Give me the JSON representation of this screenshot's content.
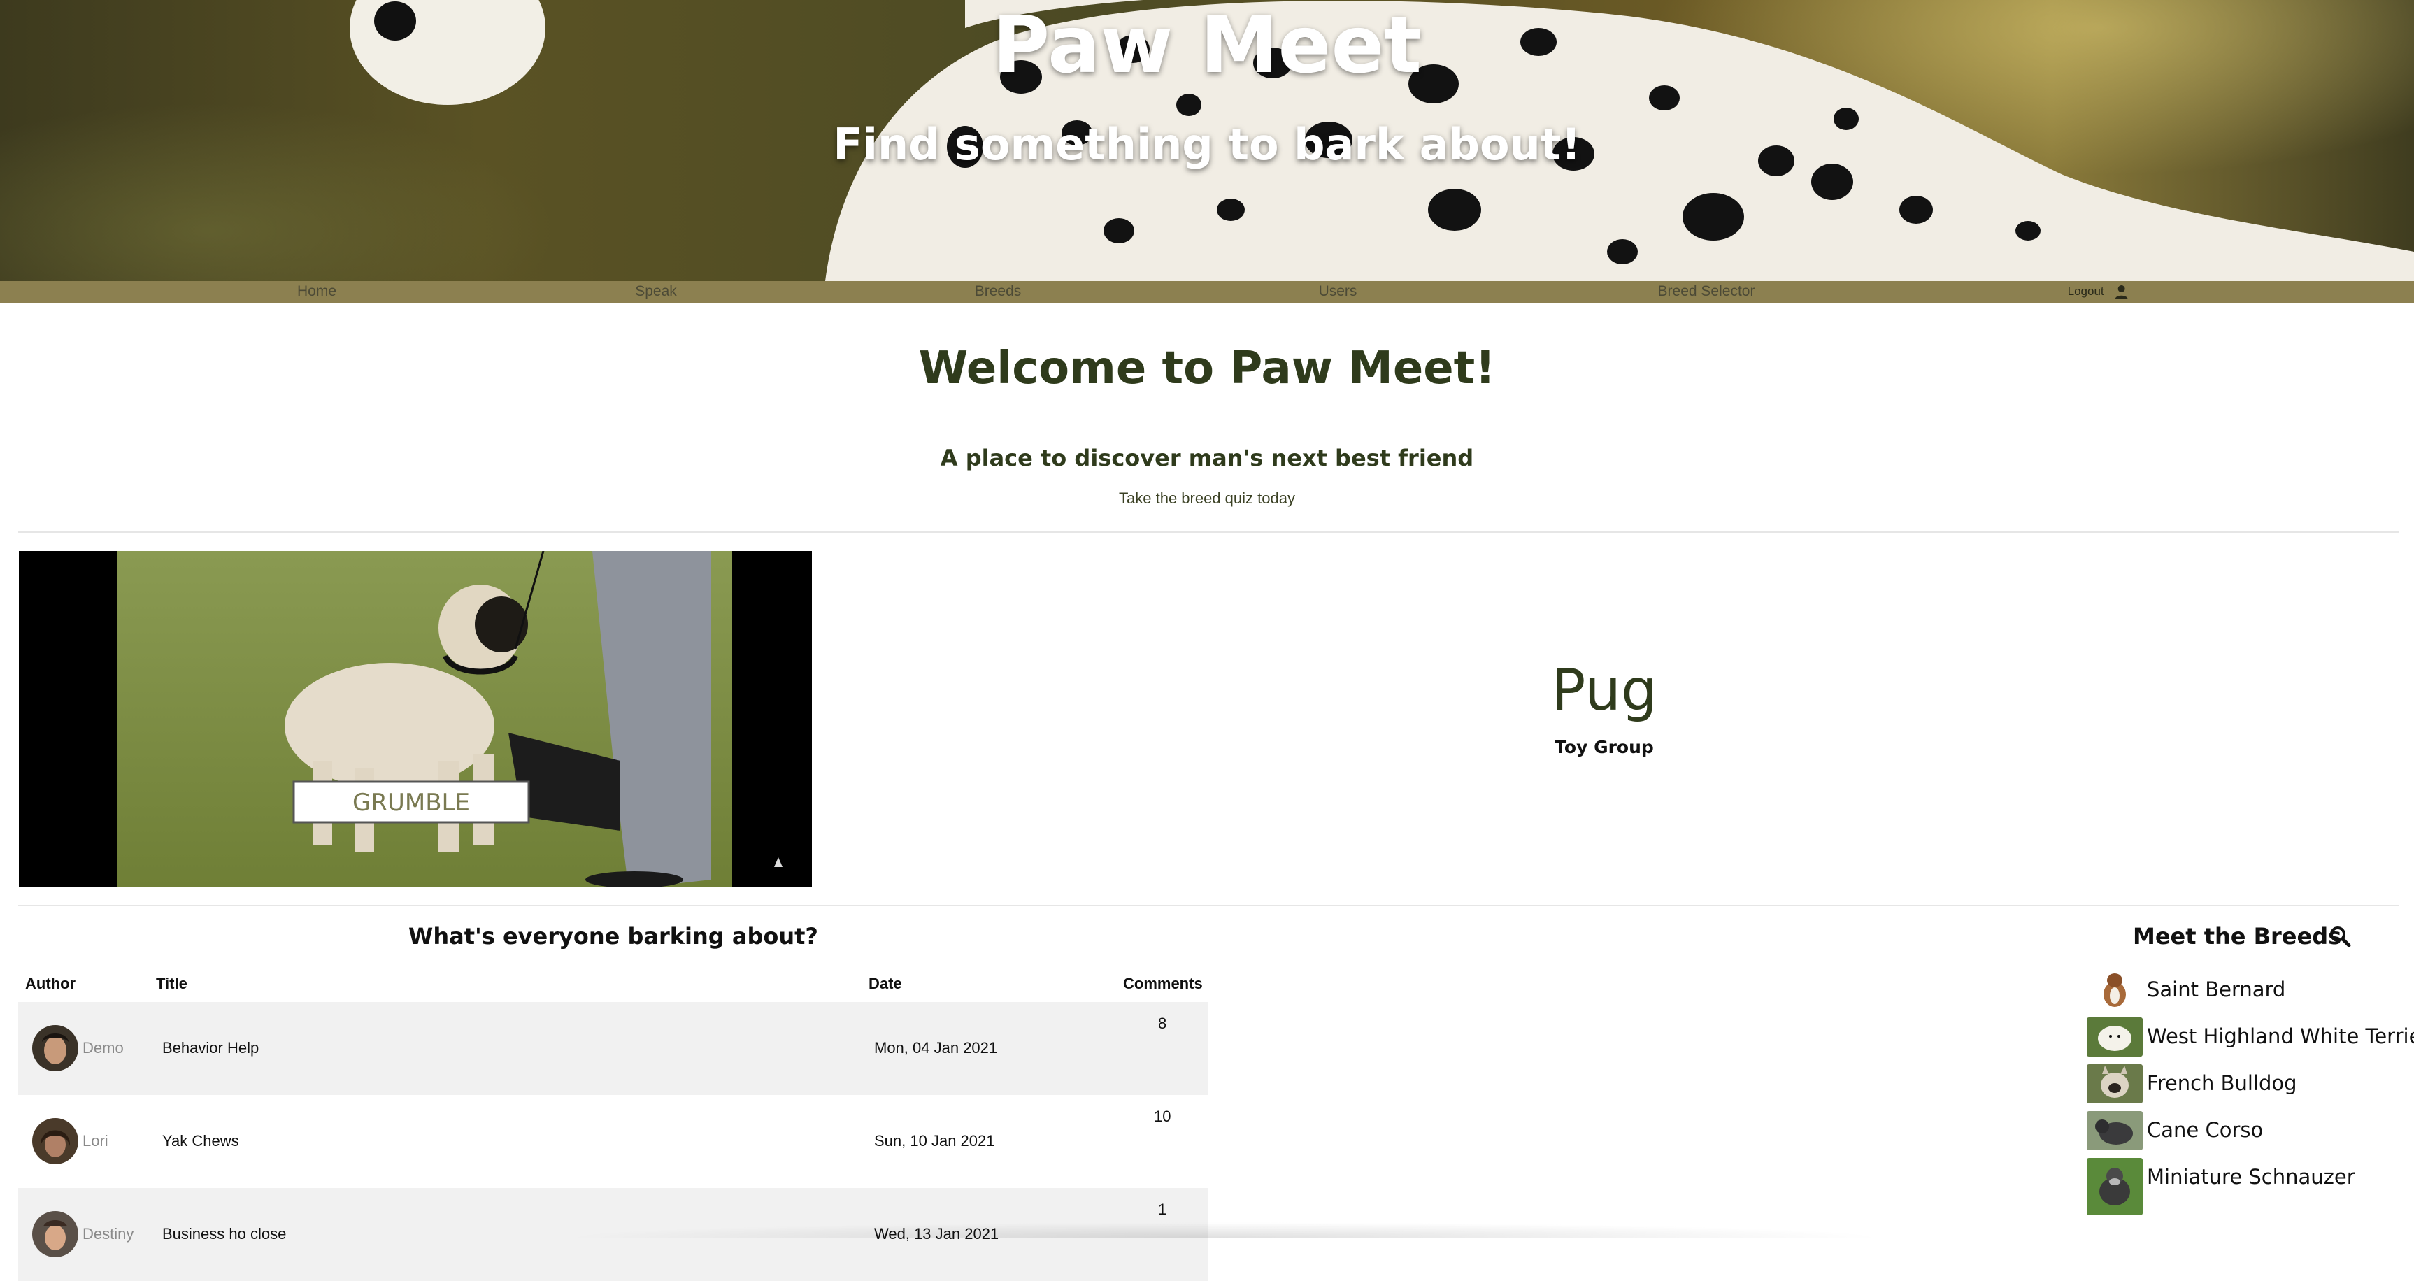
{
  "hero": {
    "title": "Paw Meet",
    "subtitle": "Find something to bark about!"
  },
  "nav": {
    "items": [
      {
        "label": "Home"
      },
      {
        "label": "Speak"
      },
      {
        "label": "Breeds"
      },
      {
        "label": "Users"
      },
      {
        "label": "Breed Selector"
      }
    ],
    "logout_label": "Logout"
  },
  "intro": {
    "welcome": "Welcome to Paw Meet!",
    "tagline": "A place to discover man's next best friend",
    "quiz_link": "Take the breed quiz today"
  },
  "featured": {
    "video_caption": "GRUMBLE",
    "breed_name": "Pug",
    "breed_group": "Toy Group"
  },
  "posts": {
    "heading": "What's everyone barking about?",
    "columns": [
      "Author",
      "Title",
      "Date",
      "Comments"
    ],
    "rows": [
      {
        "author": "Demo",
        "title": "Behavior Help",
        "date": "Mon, 04 Jan 2021",
        "comments": "8"
      },
      {
        "author": "Lori",
        "title": "Yak Chews",
        "date": "Sun, 10 Jan 2021",
        "comments": "10"
      },
      {
        "author": "Destiny",
        "title": "Business ho close",
        "date": "Wed, 13 Jan 2021",
        "comments": "1"
      }
    ]
  },
  "breeds": {
    "heading": "Meet the Breeds",
    "items": [
      {
        "name": "Saint Bernard"
      },
      {
        "name": "West Highland White Terrier"
      },
      {
        "name": "French Bulldog"
      },
      {
        "name": "Cane Corso"
      },
      {
        "name": "Miniature Schnauzer"
      }
    ]
  },
  "colors": {
    "nav_bg": "#8c8050",
    "heading_green": "#2f3b1c",
    "row_stripe": "#f1f1f1"
  },
  "icons": {
    "user": "user-icon",
    "search": "search-icon"
  }
}
